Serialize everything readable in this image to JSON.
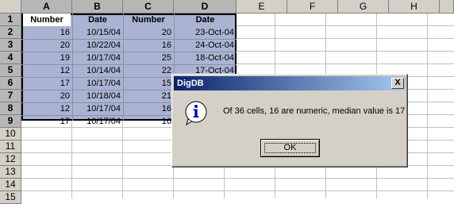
{
  "columns": [
    "A",
    "B",
    "C",
    "D",
    "E",
    "F",
    "G",
    "H"
  ],
  "rows": [
    "1",
    "2",
    "3",
    "4",
    "5",
    "6",
    "7",
    "8",
    "9",
    "10",
    "11",
    "12",
    "13",
    "14",
    "15",
    "16"
  ],
  "headers": [
    "Number",
    "Date",
    "Number",
    "Date"
  ],
  "data": [
    [
      "16",
      "10/15/04",
      "20",
      "23-Oct-04"
    ],
    [
      "20",
      "10/22/04",
      "16",
      "24-Oct-04"
    ],
    [
      "19",
      "10/17/04",
      "25",
      "18-Oct-04"
    ],
    [
      "12",
      "10/14/04",
      "22",
      "17-Oct-04"
    ],
    [
      "17",
      "10/17/04",
      "15",
      ""
    ],
    [
      "20",
      "10/18/04",
      "21",
      ""
    ],
    [
      "12",
      "10/17/04",
      "16",
      ""
    ],
    [
      "17",
      "10/17/04",
      "16",
      ""
    ]
  ],
  "dialog": {
    "title": "DigDB",
    "close_label": "X",
    "message": "Of 36 cells, 16 are numeric, median value is 17",
    "ok_label": "OK",
    "icon": "info-icon"
  },
  "colors": {
    "selection": "#aab4d2",
    "title_start": "#0a246a",
    "title_end": "#a6caf0"
  }
}
